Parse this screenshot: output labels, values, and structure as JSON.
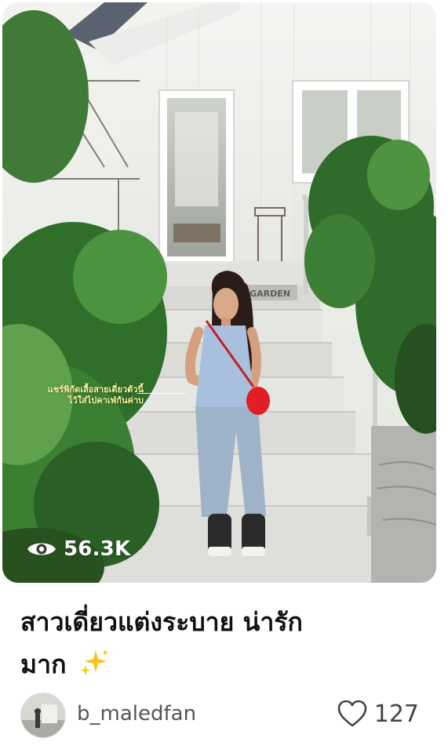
{
  "post": {
    "overlay_caption_line1": "แชร์พิกัดเสื้อสายเดี่ยวตัวนี้",
    "overlay_caption_line2": "ไว้ใส่ไปคาเฟ่กันค่าบ",
    "sign_text": "GARDEN",
    "views": "56.3K",
    "title_line1": "สาวเดี่ยวแต่งระบาย น่ารัก",
    "title_line2": "มาก",
    "title_emoji": "sparkles-icon",
    "username": "b_maledfan",
    "likes": "127"
  },
  "colors": {
    "overlay_caption": "#f7f39b",
    "sparkles": "#f5c518",
    "bag": "#e21d25",
    "text_primary": "#111111",
    "text_secondary": "#555555"
  }
}
